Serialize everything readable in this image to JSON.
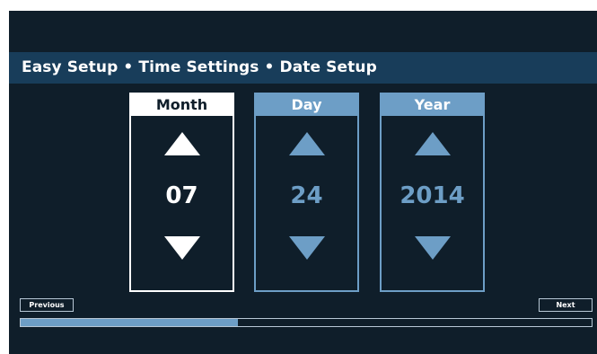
{
  "header": {
    "title": "Easy Setup • Time Settings • Date Setup"
  },
  "pickers": [
    {
      "label": "Month",
      "value": "07",
      "state": "active"
    },
    {
      "label": "Day",
      "value": "24",
      "state": "inactive"
    },
    {
      "label": "Year",
      "value": "2014",
      "state": "inactive"
    }
  ],
  "footer": {
    "previous_label": "Previous",
    "next_label": "Next",
    "progress_fraction": 0.38
  },
  "colors": {
    "background": "#0f1e2a",
    "title_bar": "#183d5a",
    "accent": "#6d9ec6",
    "active": "#ffffff"
  },
  "icons": {
    "increment": "triangle-up-icon",
    "decrement": "triangle-down-icon"
  }
}
